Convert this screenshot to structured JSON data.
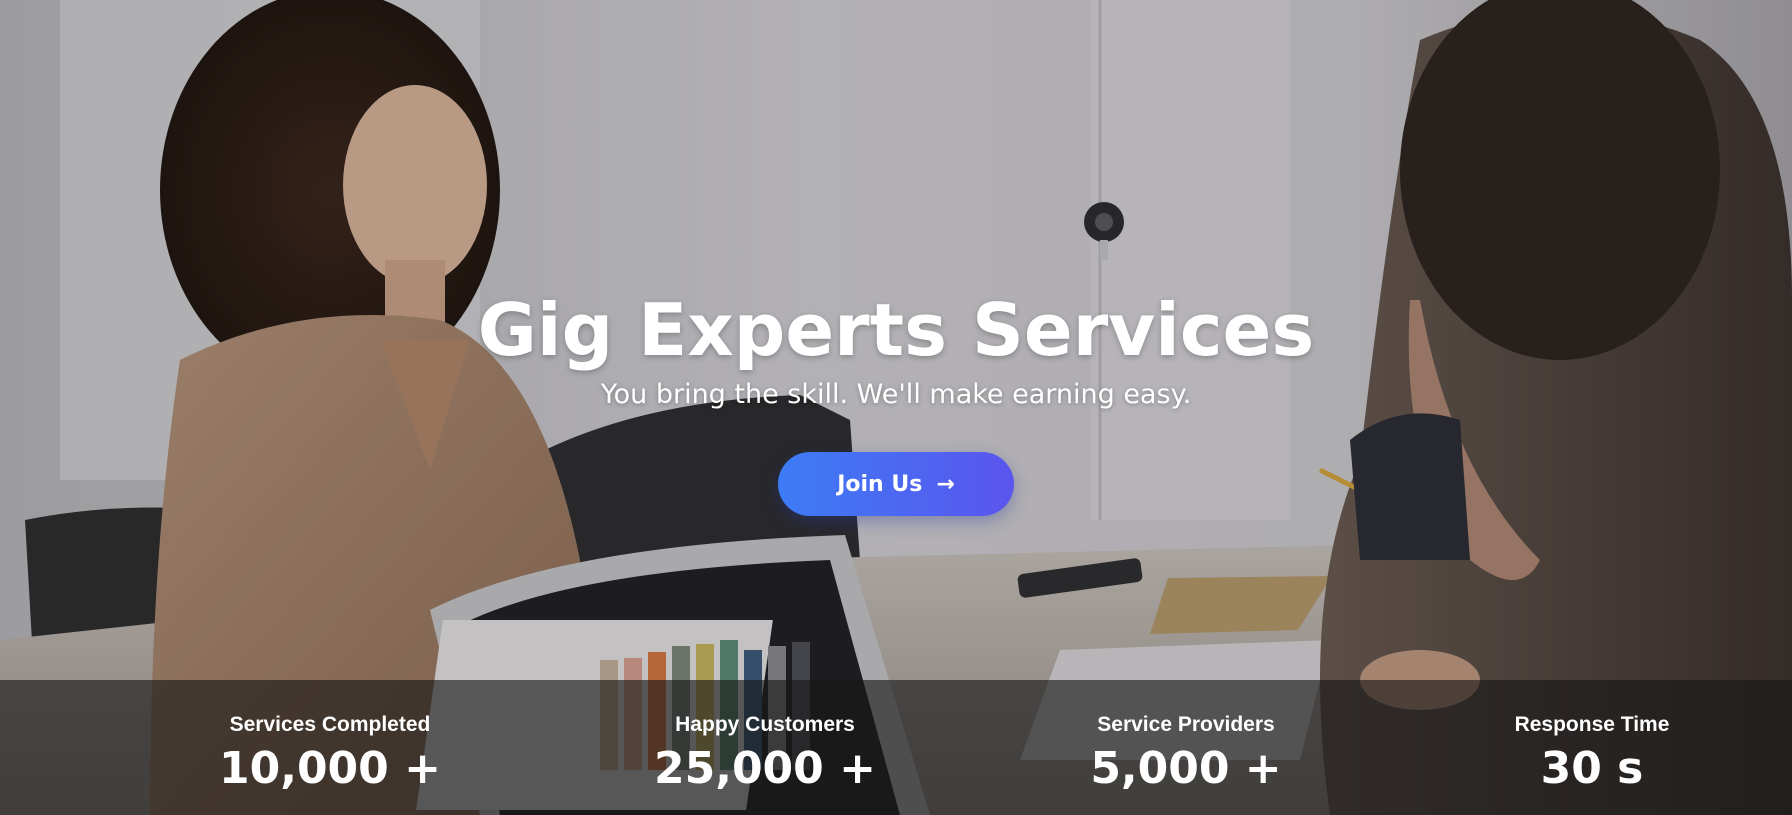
{
  "hero": {
    "title": "Gig Experts Services",
    "subtitle": "You bring the skill. We'll make earning easy.",
    "cta_label": "Join Us",
    "cta_arrow": "→",
    "cta_gradient": [
      "#3d7cf6",
      "#5a55ee"
    ]
  },
  "stats": [
    {
      "label": "Services Completed",
      "value": "10,000 +"
    },
    {
      "label": "Happy Customers",
      "value": "25,000 +"
    },
    {
      "label": "Service Providers",
      "value": "5,000 +"
    },
    {
      "label": "Response Time",
      "value": "30 s"
    }
  ]
}
